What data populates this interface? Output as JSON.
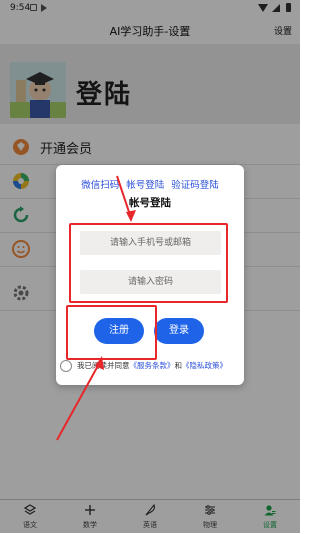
{
  "status_bar": {
    "time": "9:54"
  },
  "header": {
    "title": "AI学习助手-设置",
    "settings_label": "设置"
  },
  "profile": {
    "login_label": "登陆"
  },
  "menu": {
    "items": [
      {
        "label": "开通会员",
        "icon": "gem-icon",
        "visible": true
      },
      {
        "label": "",
        "icon": "aperture-icon",
        "visible": false
      },
      {
        "label": "",
        "icon": "refresh-icon",
        "visible": false
      },
      {
        "label": "",
        "icon": "smiley-icon",
        "visible": false
      },
      {
        "label": "",
        "icon": "gear-icon",
        "visible": false
      }
    ]
  },
  "dialog": {
    "tabs": [
      "微信扫码",
      "帐号登陆",
      "验证码登陆"
    ],
    "title": "帐号登陆",
    "phone_placeholder": "请输入手机号或邮箱",
    "password_placeholder": "请输入密码",
    "register_label": "注册",
    "login_label": "登录",
    "agree_prefix": "我已阅读并同意",
    "terms_link": "《服务条款》",
    "agree_and": "和",
    "privacy_link": "《隐私政策》"
  },
  "bottom_nav": {
    "items": [
      {
        "label": "语文",
        "icon": "layers-icon"
      },
      {
        "label": "数学",
        "icon": "plus-icon"
      },
      {
        "label": "英语",
        "icon": "feather-icon"
      },
      {
        "label": "物理",
        "icon": "sliders-icon"
      },
      {
        "label": "设置",
        "icon": "person-settings-icon",
        "active": true
      }
    ]
  },
  "colors": {
    "accent": "#1e63e8",
    "link": "#2b4fd9",
    "annotation": "#e8272b",
    "active_nav": "#19a34a"
  }
}
